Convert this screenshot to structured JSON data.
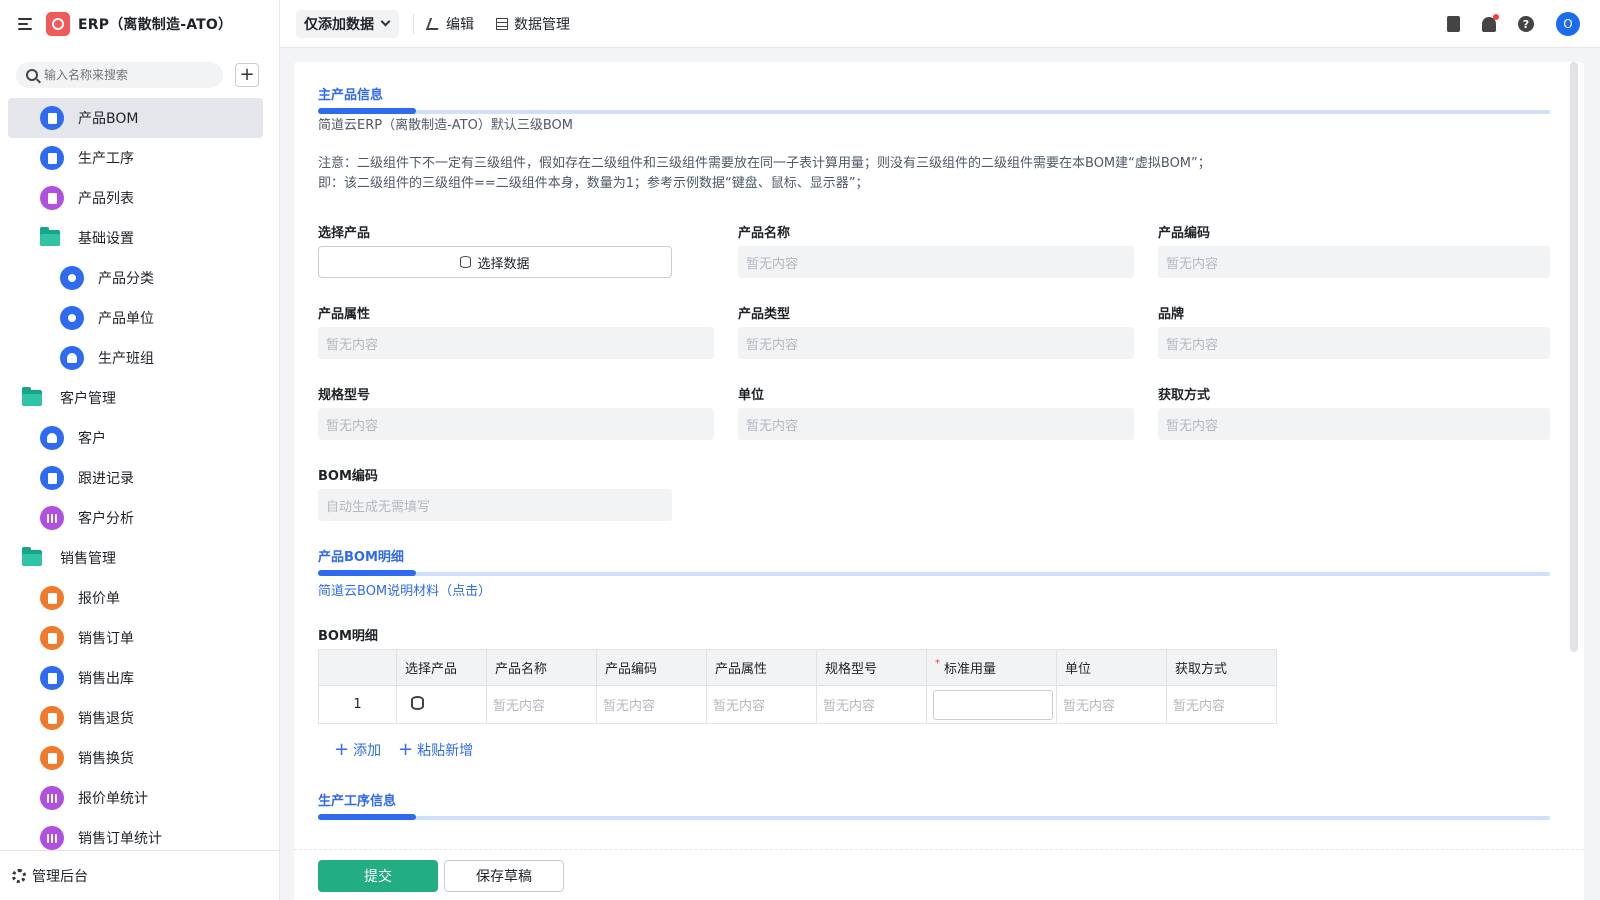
{
  "app": {
    "title": "ERP（离散制造-ATO）",
    "logo_color": "#f05a5a"
  },
  "search": {
    "placeholder": "输入名称来搜索"
  },
  "sidebar": {
    "items": [
      {
        "label": "产品BOM",
        "level": 1,
        "icon": "bom-icon",
        "color": "#2f6bf0",
        "active": true
      },
      {
        "label": "生产工序",
        "level": 1,
        "icon": "doc-icon",
        "color": "#2f6bf0"
      },
      {
        "label": "产品列表",
        "level": 1,
        "icon": "chart-card-icon",
        "color": "#b04fe0"
      },
      {
        "label": "基础设置",
        "level": 1,
        "icon": "folder-icon",
        "folder": true
      },
      {
        "label": "产品分类",
        "level": 2,
        "icon": "tag-icon",
        "color": "#2f6bf0"
      },
      {
        "label": "产品单位",
        "level": 2,
        "icon": "tag-icon",
        "color": "#2f6bf0"
      },
      {
        "label": "生产班组",
        "level": 2,
        "icon": "user-icon",
        "color": "#2f6bf0"
      },
      {
        "label": "客户管理",
        "level": 0,
        "icon": "folder-icon",
        "folder": true
      },
      {
        "label": "客户",
        "level": 1,
        "icon": "user-icon",
        "color": "#2f6bf0"
      },
      {
        "label": "跟进记录",
        "level": 1,
        "icon": "mail-icon",
        "color": "#2f6bf0"
      },
      {
        "label": "客户分析",
        "level": 1,
        "icon": "bar-chart-icon",
        "color": "#b04fe0"
      },
      {
        "label": "销售管理",
        "level": 0,
        "icon": "folder-icon",
        "folder": true
      },
      {
        "label": "报价单",
        "level": 1,
        "icon": "doc-icon",
        "color": "#f07a2a"
      },
      {
        "label": "销售订单",
        "level": 1,
        "icon": "doc-icon",
        "color": "#f07a2a"
      },
      {
        "label": "销售出库",
        "level": 1,
        "icon": "doc-icon",
        "color": "#2f6bf0"
      },
      {
        "label": "销售退货",
        "level": 1,
        "icon": "doc-icon",
        "color": "#f07a2a"
      },
      {
        "label": "销售换货",
        "level": 1,
        "icon": "doc-icon",
        "color": "#f07a2a"
      },
      {
        "label": "报价单统计",
        "level": 1,
        "icon": "bar-chart-icon",
        "color": "#b04fe0"
      },
      {
        "label": "销售订单统计",
        "level": 1,
        "icon": "bar-chart-icon",
        "color": "#b04fe0"
      }
    ],
    "footer_label": "管理后台"
  },
  "toolbar": {
    "mode_label": "仅添加数据",
    "edit_label": "编辑",
    "data_manage_label": "数据管理",
    "avatar_letter": "O",
    "help_glyph": "?"
  },
  "form": {
    "section_main": "主产品信息",
    "description": "简道云ERP（离散制造-ATO）默认三级BOM",
    "note_line1": "注意：二级组件下不一定有三级组件，假如存在二级组件和三级组件需要放在同一子表计算用量；则没有三级组件的二级组件需要在本BOM建“虚拟BOM”；",
    "note_line2": "即：该二级组件的三级组件==二级组件本身，数量为1；参考示例数据“键盘、鼠标、显示器”；",
    "empty_text": "暂无内容",
    "select_data_label": "选择数据",
    "fields": {
      "select_product": "选择产品",
      "product_name": "产品名称",
      "product_code": "产品编码",
      "product_attr": "产品属性",
      "product_type": "产品类型",
      "brand": "品牌",
      "spec": "规格型号",
      "unit": "单位",
      "acquire": "获取方式",
      "bom_code": "BOM编码"
    },
    "bom_code_placeholder": "自动生成无需填写",
    "section_bom": "产品BOM明细",
    "bom_link": "简道云BOM说明材料（点击）",
    "bom_detail_label": "BOM明细",
    "table": {
      "headers": [
        "选择产品",
        "产品名称",
        "产品编码",
        "产品属性",
        "规格型号",
        "标准用量",
        "单位",
        "获取方式"
      ],
      "row_number": "1",
      "required_mark": "*"
    },
    "add_label": "添加",
    "paste_add_label": "粘贴新增",
    "section_process": "生产工序信息"
  },
  "footer": {
    "submit_label": "提交",
    "save_draft_label": "保存草稿"
  },
  "colors": {
    "accent": "#2f6bf0",
    "submit": "#22ad82",
    "folder": "#17a58a"
  }
}
